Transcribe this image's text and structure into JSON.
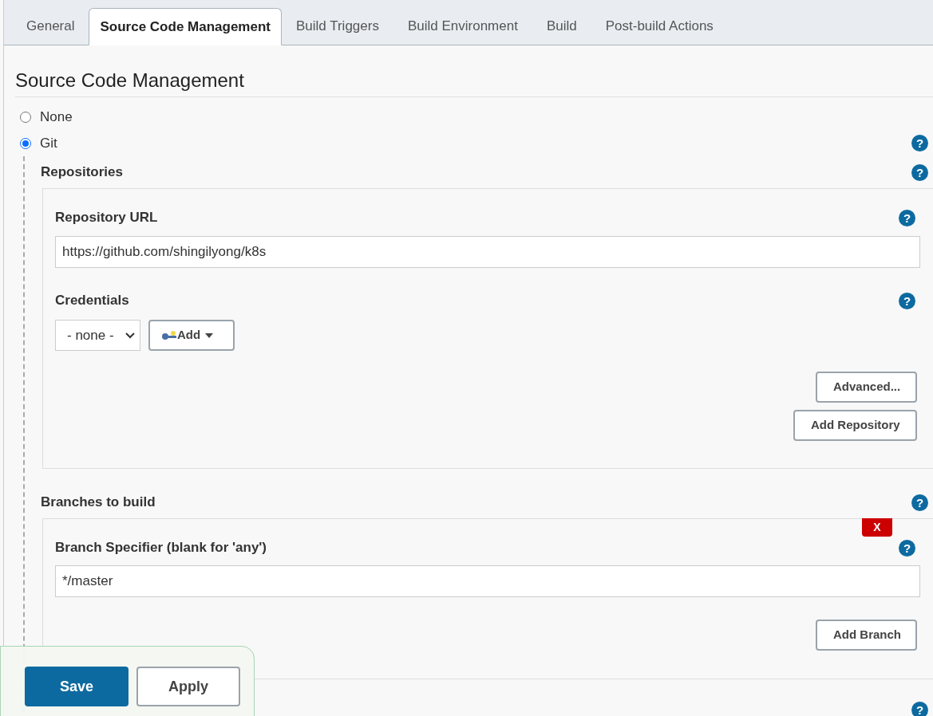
{
  "tabs": [
    {
      "label": "General",
      "selected": false
    },
    {
      "label": "Source Code Management",
      "selected": true
    },
    {
      "label": "Build Triggers",
      "selected": false
    },
    {
      "label": "Build Environment",
      "selected": false
    },
    {
      "label": "Build",
      "selected": false
    },
    {
      "label": "Post-build Actions",
      "selected": false
    }
  ],
  "section_title": "Source Code Management",
  "scm_options": [
    {
      "label": "None",
      "selected": false
    },
    {
      "label": "Git",
      "selected": true
    }
  ],
  "help_icon": "?",
  "repositories": {
    "label": "Repositories",
    "repository_url": {
      "label": "Repository URL",
      "value": "https://github.com/shingilyong/k8s"
    },
    "credentials": {
      "label": "Credentials",
      "select": "- none -",
      "add_button": "Add"
    },
    "advanced_button": "Advanced...",
    "add_repository_button": "Add Repository"
  },
  "branches": {
    "label": "Branches to build",
    "delete_button": "X",
    "specifier": {
      "label": "Branch Specifier (blank for 'any')",
      "value": "*/master"
    },
    "add_branch_button": "Add Branch"
  },
  "footer_buttons": [
    {
      "label": "Save",
      "kind": "primary"
    },
    {
      "label": "Apply",
      "kind": "secondary"
    }
  ]
}
